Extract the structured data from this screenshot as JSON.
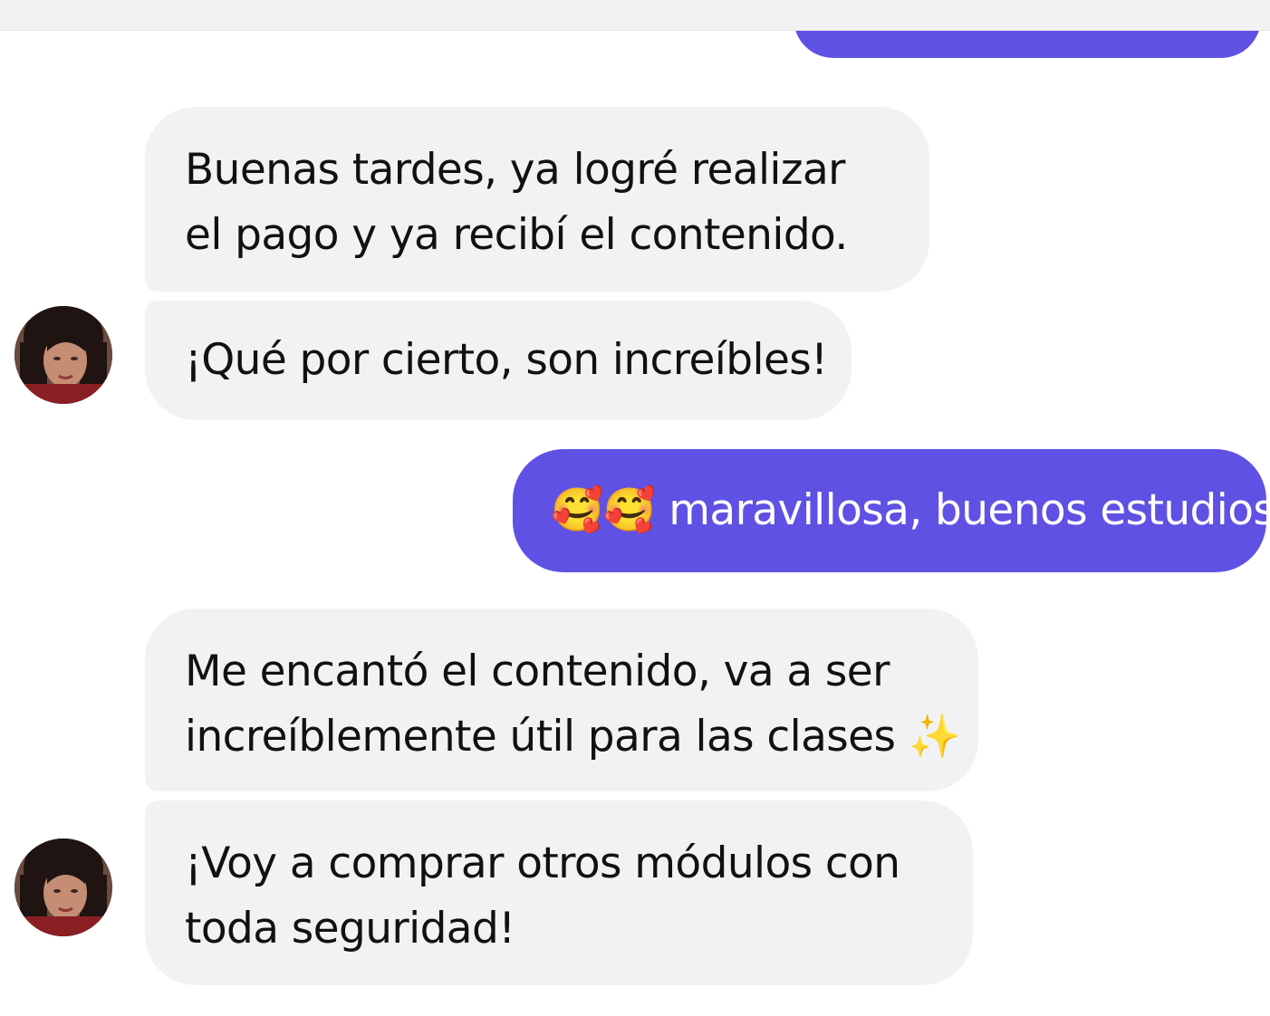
{
  "messages": [
    {
      "direction": "incoming",
      "lines": [
        "Buenas tardes, ya logré realizar",
        "el pago y ya recibí el contenido."
      ]
    },
    {
      "direction": "incoming",
      "lines": [
        "¡Qué por cierto, son increíbles!"
      ]
    },
    {
      "direction": "outgoing",
      "emoji": "🥰🥰",
      "text": "maravillosa, buenos estudios"
    },
    {
      "direction": "incoming",
      "lines": [
        "Me encantó el contenido, va a ser",
        "increíblemente útil para las clases"
      ],
      "emoji": "✨"
    },
    {
      "direction": "incoming",
      "lines": [
        "¡Voy a comprar otros módulos con",
        "toda seguridad!"
      ]
    }
  ],
  "colors": {
    "outgoing_bubble": "#5f51e3",
    "incoming_bubble": "#f2f2f5",
    "background": "#ffffff"
  },
  "icons": {
    "avatar": "user-avatar",
    "smiling_hearts": "smiling-face-with-hearts-icon",
    "sparkles": "sparkles-icon"
  }
}
